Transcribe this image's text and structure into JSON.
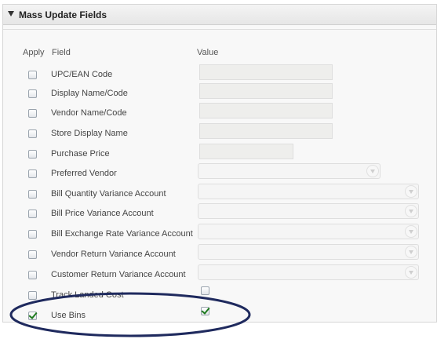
{
  "section": {
    "title": "Mass Update Fields"
  },
  "columns": {
    "apply": "Apply",
    "field": "Field",
    "value": "Value"
  },
  "rows": [
    {
      "label": "UPC/EAN Code",
      "apply_checked": false,
      "control": "text"
    },
    {
      "label": "Display Name/Code",
      "apply_checked": false,
      "control": "text"
    },
    {
      "label": "Vendor Name/Code",
      "apply_checked": false,
      "control": "text"
    },
    {
      "label": "Store Display Name",
      "apply_checked": false,
      "control": "text"
    },
    {
      "label": "Purchase Price",
      "apply_checked": false,
      "control": "text"
    },
    {
      "label": "Preferred Vendor",
      "apply_checked": false,
      "control": "select"
    },
    {
      "label": "Bill Quantity Variance Account",
      "apply_checked": false,
      "control": "select"
    },
    {
      "label": "Bill Price Variance Account",
      "apply_checked": false,
      "control": "select"
    },
    {
      "label": "Bill Exchange Rate Variance Account",
      "apply_checked": false,
      "control": "select"
    },
    {
      "label": "Vendor Return Variance Account",
      "apply_checked": false,
      "control": "select"
    },
    {
      "label": "Customer Return Variance Account",
      "apply_checked": false,
      "control": "select"
    },
    {
      "label": "Track Landed Cost",
      "apply_checked": false,
      "control": "checkbox",
      "value_checked": false
    },
    {
      "label": "Use Bins",
      "apply_checked": true,
      "control": "checkbox",
      "value_checked": true
    }
  ],
  "colors": {
    "annotation_ellipse": "#1f2a5e",
    "check_green": "#1d7a1d"
  }
}
